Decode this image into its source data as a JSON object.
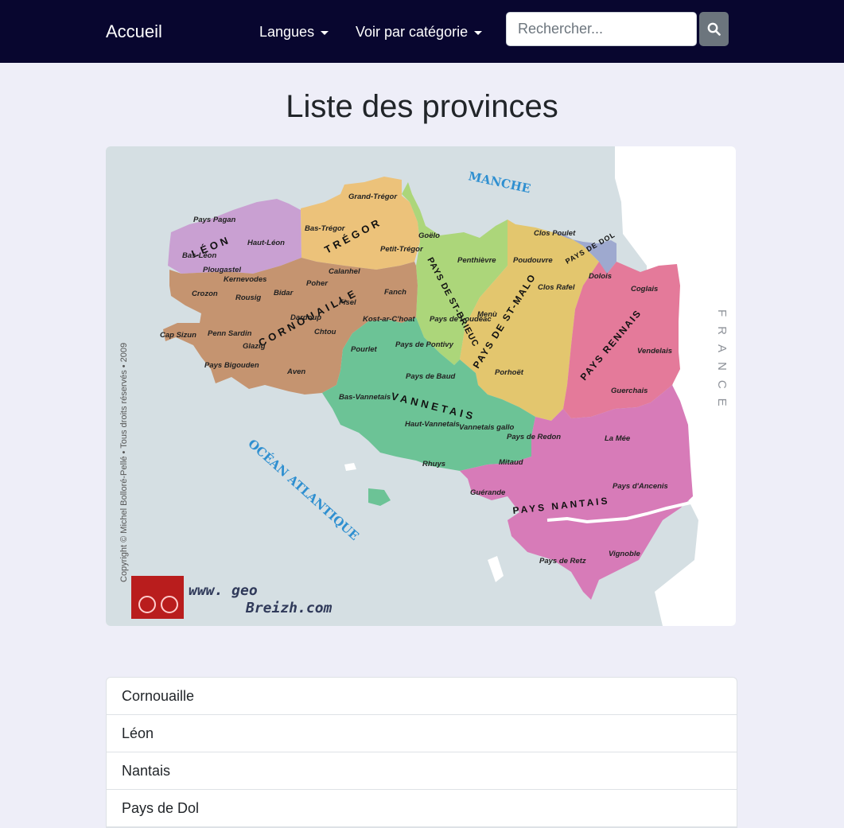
{
  "navbar": {
    "brand": "Accueil",
    "languages_label": "Langues",
    "categories_label": "Voir par catégorie",
    "search_placeholder": "Rechercher...",
    "search_icon": "search-icon",
    "background_color": "#08062f"
  },
  "page": {
    "title": "Liste des provinces",
    "background_color": "#eeeef8"
  },
  "map": {
    "sea_labels": [
      "MANCHE",
      "OCÉAN ATLANTIQUE"
    ],
    "country_label": "FRANCE",
    "copyright": "Copyright © Michel Bolloré-Pellé • Tous droits réservés • 2009",
    "logo_text": [
      "www. geo",
      "Breizh.com"
    ],
    "region_labels": {
      "leon": "LÉON",
      "tregor": "TRÉGOR",
      "cornouaille": "CORNOUAILLE",
      "vannetais": "VANNETAIS",
      "st_brieuc": "PAYS DE ST-BRIEUC",
      "st_malo": "PAYS DE ST-MALO",
      "dol": "PAYS DE DOL",
      "rennais": "PAYS RENNAIS",
      "nantais": "PAYS NANTAIS"
    },
    "place_labels": {
      "grand_tregor": "Grand-Trégor",
      "pays_pagan": "Pays Pagan",
      "haut_leon": "Haut-Léon",
      "bas_leon": "Bas-Léon",
      "bas_tregor": "Bas-Trégor",
      "petit_tregor": "Petit-Trégor",
      "goelo": "Goëlo",
      "clos_poulet": "Clos Poulet",
      "penthievre": "Penthièvre",
      "poudouvre": "Poudouvre",
      "dolois": "Dolois",
      "clos_rafel": "Clos Rafel",
      "coglais": "Coglais",
      "plougastel": "Plougastel",
      "kernevodes": "Kernevodes",
      "calanhel": "Calanhel",
      "poher": "Poher",
      "crozon": "Crozon",
      "rousig": "Rousig",
      "bidar": "Bidar",
      "fisel": "Fisel",
      "fanch": "Fanch",
      "dardoup": "Dardoup",
      "menu": "Menù",
      "kost_ar_choat": "Kost-ar-C'hoat",
      "pays_loudeac": "Pays de Loudéac",
      "cap_sizun": "Cap Sizun",
      "penn_sardin": "Penn Sardin",
      "chtou": "Chtou",
      "glazig": "Glazig",
      "pourlet": "Pourlet",
      "pays_pontivy": "Pays de Pontivy",
      "vendelais": "Vendelais",
      "pays_bigouden": "Pays Bigouden",
      "aven": "Aven",
      "porhoet": "Porhoët",
      "pays_baud": "Pays de Baud",
      "bas_vannetais": "Bas-Vannetais",
      "guerchais": "Guerchais",
      "haut_vannetais": "Haut-Vannetais",
      "vannetais_gallo": "Vannetais gallo",
      "pays_redon": "Pays de Redon",
      "la_mee": "La Mée",
      "rhuys": "Rhuys",
      "mitaud": "Mitaud",
      "guerande": "Guérande",
      "pays_ancenis": "Pays d'Ancenis",
      "vignoble": "Vignoble",
      "pays_retz": "Pays de Retz"
    },
    "region_colors": {
      "leon": "#c9a0d2",
      "tregor": "#ecc27a",
      "cornouaille": "#c59470",
      "vannetais": "#6cc396",
      "st_brieuc": "#acd67a",
      "st_malo": "#e3c66e",
      "dol": "#9ea9cf",
      "rennais": "#e47a9a",
      "nantais": "#d77bb8"
    }
  },
  "provinces": [
    "Cornouaille",
    "Léon",
    "Nantais",
    "Pays de Dol"
  ]
}
